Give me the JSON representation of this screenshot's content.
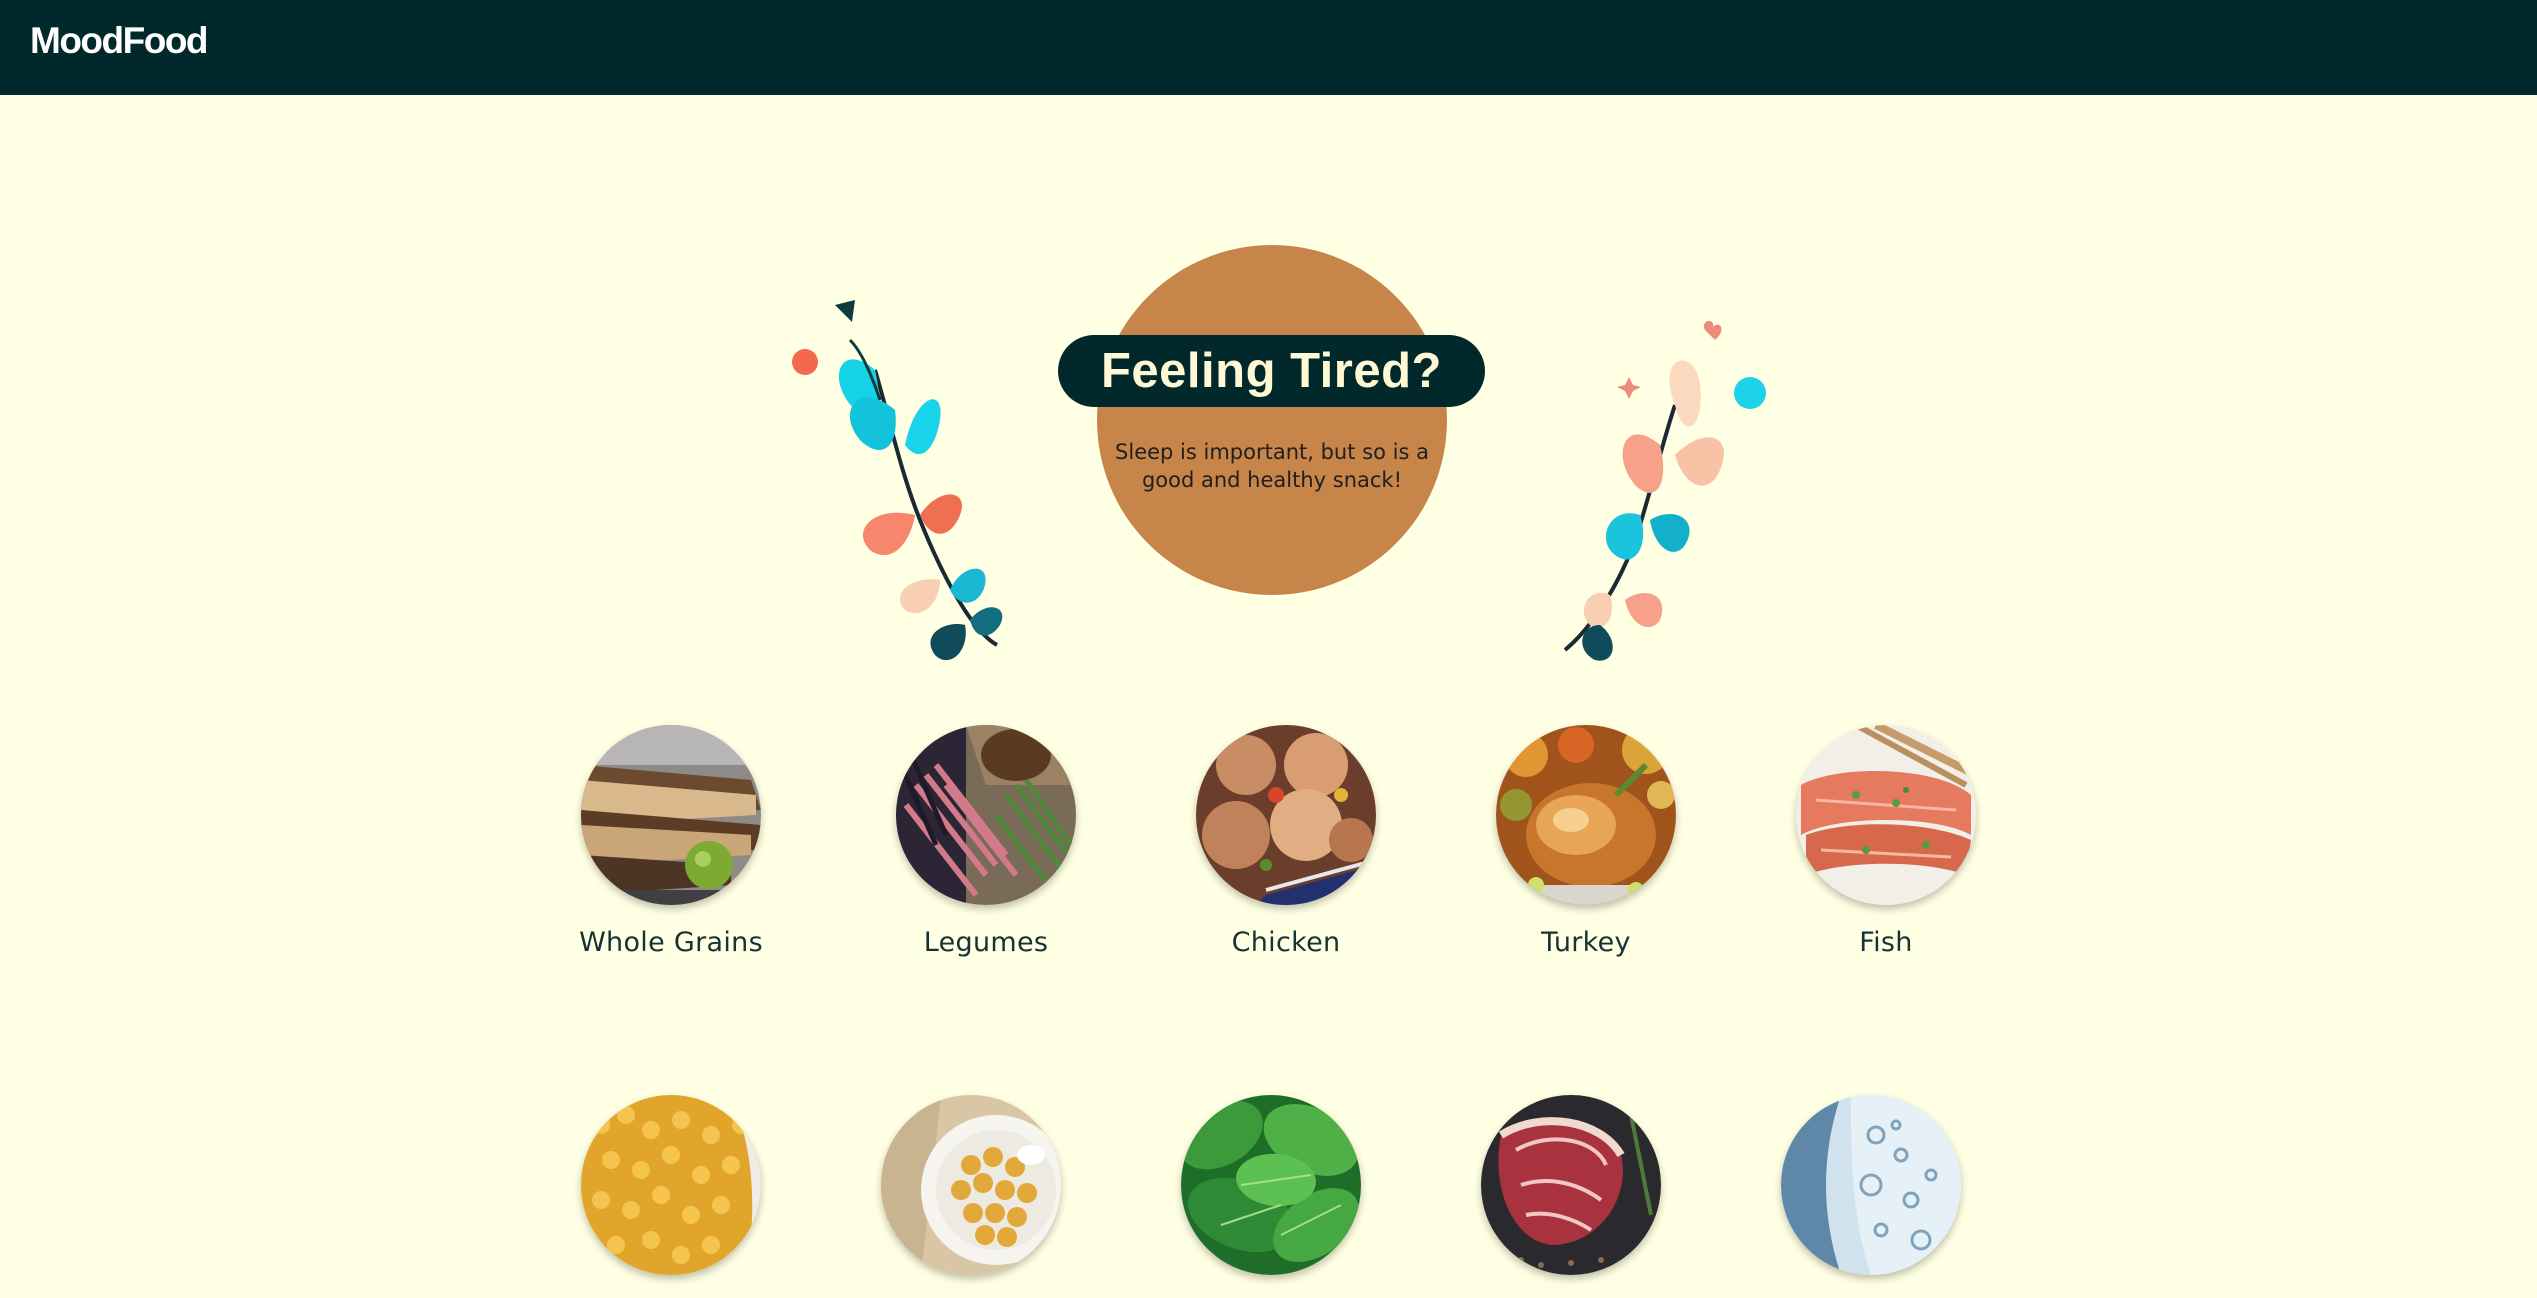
{
  "navbar": {
    "brand": "MoodFood"
  },
  "hero": {
    "title": "Feeling Tired?",
    "subtitle": "Sleep is important, but so is a good and healthy snack!"
  },
  "foods": [
    {
      "label": "Whole Grains",
      "image": "whole-grain-bread-photo"
    },
    {
      "label": "Legumes",
      "image": "legumes-beans-photo"
    },
    {
      "label": "Chicken",
      "image": "roast-chicken-photo"
    },
    {
      "label": "Turkey",
      "image": "roast-turkey-photo"
    },
    {
      "label": "Fish",
      "image": "salmon-fillet-photo"
    },
    {
      "label": "",
      "image": "split-peas-photo"
    },
    {
      "label": "",
      "image": "chickpeas-bowl-photo"
    },
    {
      "label": "",
      "image": "spinach-leaves-photo"
    },
    {
      "label": "",
      "image": "raw-steak-photo"
    },
    {
      "label": "",
      "image": "sparkling-water-photo"
    }
  ],
  "colors": {
    "background": "#FFFFE3",
    "navbar": "#01292B",
    "accent": "#C7854A"
  }
}
